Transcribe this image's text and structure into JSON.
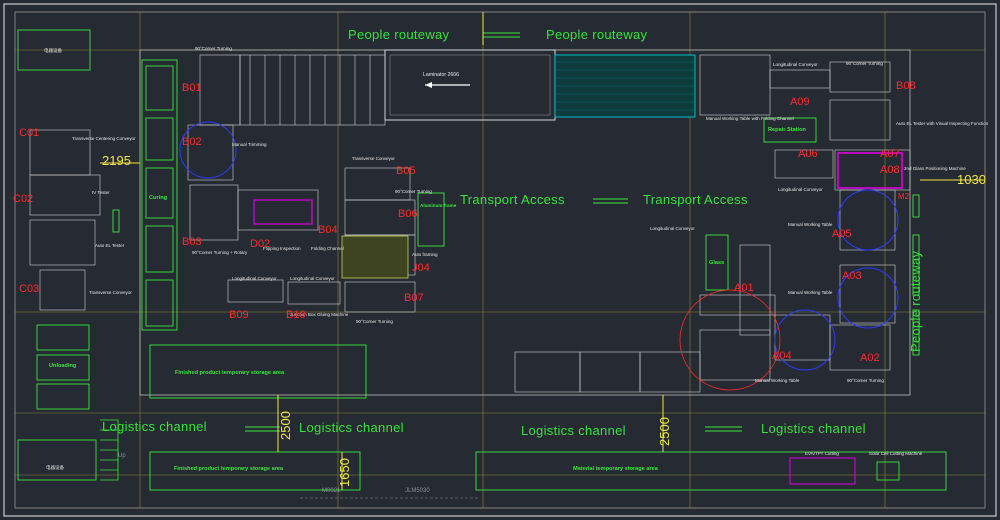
{
  "colors": {
    "background": "#262a33",
    "wall": "#c9c9c9",
    "conveyor": "#d8d8d8",
    "zone": "#39e83a",
    "code": "#ff2a2a",
    "dimension": "#f0e64a",
    "magenta": "#e000e0",
    "cyan": "#00c8d8",
    "blue": "#2a3cff",
    "gridline": "#8a8a30"
  },
  "routes": {
    "people_routeway_left": "People routeway",
    "people_routeway_right": "People routeway",
    "people_routeway_vertical": "People routeway",
    "transport_left": "Transport Access",
    "transport_right": "Transport Access",
    "logistics_1": "Logistics channel",
    "logistics_2": "Logistics channel",
    "logistics_3": "Logistics channel",
    "logistics_4": "Logistics channel"
  },
  "dimensions": {
    "d2195": "2195",
    "d1030": "1030",
    "d2500a": "2500",
    "d2500b": "2500",
    "d1650": "1650"
  },
  "zones": {
    "finished_storage_1": "Finished product temporary storage area",
    "finished_storage_2": "Finished product temporary storage area",
    "material_storage": "Material temporary storage area",
    "unloading": "Unloading",
    "curing": "Curing",
    "glass": "Glass",
    "aluminum_frame": "Aluminum frame",
    "repair_station": "Repair Station",
    "eva_tpt": "EVA/TPT Cutting",
    "cell_cutting": "Solar Cell Cutting Machine",
    "laminator": "Laminator 2666",
    "room_top_left": "电器设备",
    "room_bottom_left": "电器设备"
  },
  "machines": {
    "corner_top": "90°Corner Turning",
    "manual_trimming": "Manual Trimming",
    "transverse_centering": "Transverse Centering Conveyor",
    "iv_tester": "IV Tester",
    "auto_el": "Auto EL Tester",
    "transverse_conveyor": "Transverse Conveyor",
    "corner_rotary": "90°Corner Turning + Rotary",
    "flipping": "Flipping Inspection",
    "folding": "Folding Channel",
    "transverse_conveyor2": "Transverse Conveyor",
    "corner_turning_b05": "90°Corner Turning",
    "auto_framing": "Auto framing",
    "longitudinal1": "Longitudinal Conveyor",
    "longitudinal2": "Longitudinal Conveyor",
    "box_gluing": "Junction Box Gluing Machine",
    "corner_b07": "90°Corner Turning",
    "longitudinal_top": "Longitudinal Conveyor",
    "corner_top_right": "90°Corner Turning",
    "manual_table_fold": "Manual Working Table with Folding Channel",
    "auto_el_visual": "Auto EL Tester with Visual Inspecting Function",
    "glass_positioning": "2nd Glass Positioning Machine",
    "longitudinal_mid": "Longitudinal Conveyor",
    "manual_table1": "Manual Working Table",
    "longitudinal_glass": "Longitudinal Conveyor",
    "manual_table2": "Manual Working Table",
    "manual_table3": "Manual Working Table",
    "corner_bottom_right": "90°Corner Turning",
    "up": "Up"
  },
  "codes": {
    "B01": "B01",
    "B02": "B02",
    "B03": "B03",
    "B04": "B04",
    "B05": "B05",
    "B06": "B06",
    "B07": "B07",
    "B08": "B08",
    "B09": "B09",
    "B10": "B10",
    "C01": "C01",
    "C02": "C02",
    "C03": "C03",
    "A01": "A01",
    "A02": "A02",
    "A03": "A03",
    "A04": "A04",
    "A05": "A05",
    "A06": "A06",
    "A07": "A07",
    "A08": "A08",
    "A09": "A09",
    "D02": "D02",
    "J04": "J04",
    "M2": "M2"
  },
  "footer": {
    "col1": "M0921",
    "col2": "JLM5030"
  }
}
